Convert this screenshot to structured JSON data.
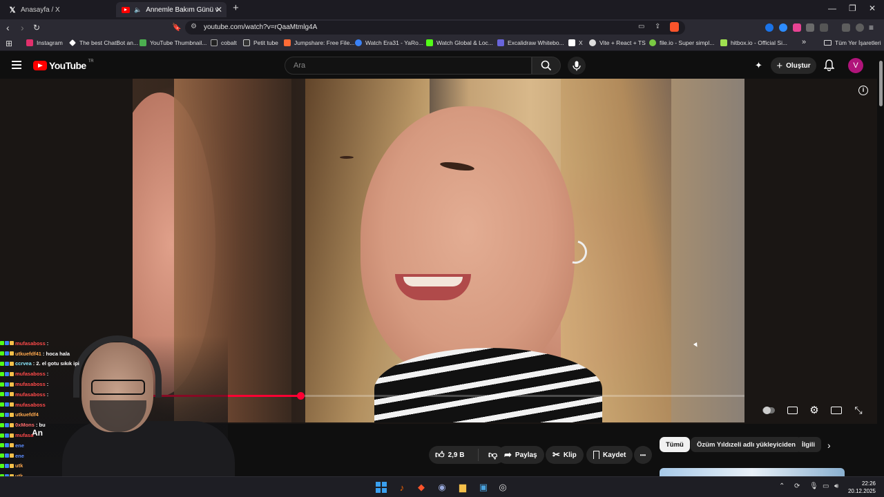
{
  "browser": {
    "tabs": [
      {
        "title": "Anasayfa / X",
        "icon": "x-logo-icon",
        "active": false
      },
      {
        "title": "Annemle Bakım Günü w/ Mo",
        "icon": "youtube-favicon-icon",
        "active": true,
        "audio": true
      }
    ],
    "new_tab_label": "+",
    "url": "youtube.com/watch?v=rQaaMtmlg4A",
    "bookmarks": [
      {
        "label": "Instagram",
        "color": "#e1306c"
      },
      {
        "label": "The best ChatBot an...",
        "color": "#ffffff"
      },
      {
        "label": "YouTube Thumbnail...",
        "color": "#4caf50"
      },
      {
        "label": "cobalt",
        "color": "#ffffff"
      },
      {
        "label": "Petit tube",
        "color": "#ffffff"
      },
      {
        "label": "Jumpshare: Free File...",
        "color": "#ff6b35"
      },
      {
        "label": "Watch Era31 - YaRo...",
        "color": "#3b82f6"
      },
      {
        "label": "Watch Global & Loc...",
        "color": "#53fc18"
      },
      {
        "label": "Excalidraw Whitebo...",
        "color": "#6965db"
      },
      {
        "label": "X",
        "color": "#ffffff"
      },
      {
        "label": "Vite + React + TS",
        "color": "#ffffff"
      },
      {
        "label": "file.io - Super simpl...",
        "color": "#7ac943"
      },
      {
        "label": "hitbox.io - Official Si...",
        "color": "#a0e050"
      }
    ],
    "overflow_label": "»",
    "all_bookmarks_label": "Tüm Yer İşaretleri"
  },
  "youtube": {
    "logo_text": "YouTube",
    "country_code": "TR",
    "search_placeholder": "Ara",
    "create_label": "Oluştur",
    "avatar_letter": "V",
    "progress_fraction": 0.274
  },
  "actions": {
    "like_count": "2,9 B",
    "share_label": "Paylaş",
    "clip_label": "Klip",
    "save_label": "Kaydet",
    "more_label": "•••"
  },
  "chips": [
    {
      "label": "Tümü",
      "active": true
    },
    {
      "label": "Özüm Yıldızeli adlı yükleyiciden",
      "active": false
    },
    {
      "label": "İlgili",
      "active": false
    }
  ],
  "chat": [
    {
      "name": "mufasaboss",
      "msg": ":",
      "color": "#ff4a4a"
    },
    {
      "name": "utkuefdf41",
      "msg": ": hoca hala",
      "color": "#ffa94d"
    },
    {
      "name": "ccrvea",
      "msg": ": 2. el gotu sıkık ipi",
      "color": "#8be9fd"
    },
    {
      "name": "mufasaboss",
      "msg": ":",
      "color": "#ff4a4a"
    },
    {
      "name": "mufasaboss",
      "msg": ":",
      "color": "#ff4a4a"
    },
    {
      "name": "mufasaboss",
      "msg": ":",
      "color": "#ff4a4a"
    },
    {
      "name": "mufasaboss",
      "msg": "",
      "color": "#ff4a4a"
    },
    {
      "name": "utkuefdf4",
      "msg": "",
      "color": "#ffa94d"
    },
    {
      "name": "0xMons",
      "msg": ": bu",
      "color": "#ff6b6b"
    },
    {
      "name": "mufasa",
      "msg": "",
      "color": "#ff4a4a"
    },
    {
      "name": "ene",
      "msg": "",
      "color": "#5b8cff"
    },
    {
      "name": "ene",
      "msg": "",
      "color": "#5b8cff"
    },
    {
      "name": "utk",
      "msg": "",
      "color": "#ffa94d"
    },
    {
      "name": "utk",
      "msg": "",
      "color": "#ffa94d"
    },
    {
      "name": "0xM",
      "msg": "",
      "color": "#ff6b6b"
    }
  ],
  "overlay_text": "An",
  "taskbar": {
    "time": "22:26",
    "date": "20.12.2025"
  }
}
